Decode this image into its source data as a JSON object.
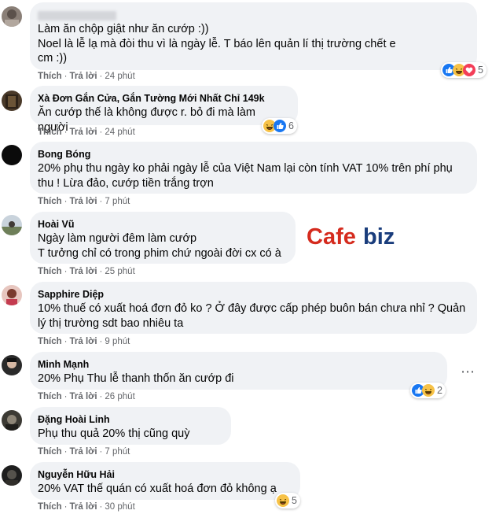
{
  "comments": [
    {
      "author": "",
      "lines": [
        "Làm ăn chộp giật như ăn cướp :))",
        "Noel là lễ lạ  mà đòi thu vì là ngày lễ. T báo lên quản lí thị trường chết  e",
        "cm :))"
      ],
      "like_label": "Thích",
      "reply_label": "Trả lời",
      "time": "24 phút",
      "reaction_count": "5"
    },
    {
      "author": "Xà Đơn Gắn Cửa, Gắn Tường Mới Nhất Chỉ 149k",
      "lines": [
        "Ăn cướp thế là không được r. bỏ đi mà làm người"
      ],
      "like_label": "Thích",
      "reply_label": "Trả lời",
      "time": "24 phút",
      "reaction_count": "6"
    },
    {
      "author": "Bong Bóng",
      "lines": [
        "20% phụ thu ngày ko phải ngày lễ của Việt Nam lại còn tính VAT 10% trên phí phụ",
        "thu ! Lừa đảo, cướp tiền trắng trợn"
      ],
      "like_label": "Thích",
      "reply_label": "Trả lời",
      "time": "7 phút"
    },
    {
      "author": "Hoài Vũ",
      "lines": [
        "Ngày làm người đêm làm cướp",
        "T tưởng chỉ có trong phim chứ ngoài đời cx có à"
      ],
      "like_label": "Thích",
      "reply_label": "Trả lời",
      "time": "25 phút"
    },
    {
      "author": "Sapphire Diệp",
      "lines": [
        "10% thuế có xuất hoá đơn đỏ ko ? Ở đây được cấp phép buôn bán chưa nhỉ ? Quản",
        "lý thị trường sdt bao nhiêu ta"
      ],
      "like_label": "Thích",
      "reply_label": "Trả lời",
      "time": "9 phút"
    },
    {
      "author": "Minh Mạnh",
      "lines": [
        "20% Phụ Thu lễ  thanh thốn  ăn cướp đi"
      ],
      "like_label": "Thích",
      "reply_label": "Trả lời",
      "time": "26 phút",
      "reaction_count": "2"
    },
    {
      "author": "Đặng Hoài Linh",
      "lines": [
        "Phụ thu quả 20% thị  cũng quỳ"
      ],
      "like_label": "Thích",
      "reply_label": "Trả lời",
      "time": "7 phút"
    },
    {
      "author": "Nguyễn Hữu Hải",
      "lines": [
        "20% VAT thế quán có xuất hoá đơn đỏ không ạ"
      ],
      "like_label": "Thích",
      "reply_label": "Trả lời",
      "time": "30 phút",
      "reaction_count": "5"
    }
  ],
  "watermark": {
    "part1": "Cafe",
    "part2": "biz"
  },
  "colors": {
    "bubble": "#f0f2f5",
    "meta": "#65676b",
    "like_blue": "#1877f2",
    "haha_yellow": "#f7c247",
    "love_red": "#f33e58",
    "watermark_red": "#d52b1e",
    "watermark_blue": "#1a3d7c"
  },
  "icons": {
    "like": "thumbs-up-icon",
    "haha": "laughing-face-icon",
    "love": "heart-icon",
    "more": "more-options-icon"
  }
}
